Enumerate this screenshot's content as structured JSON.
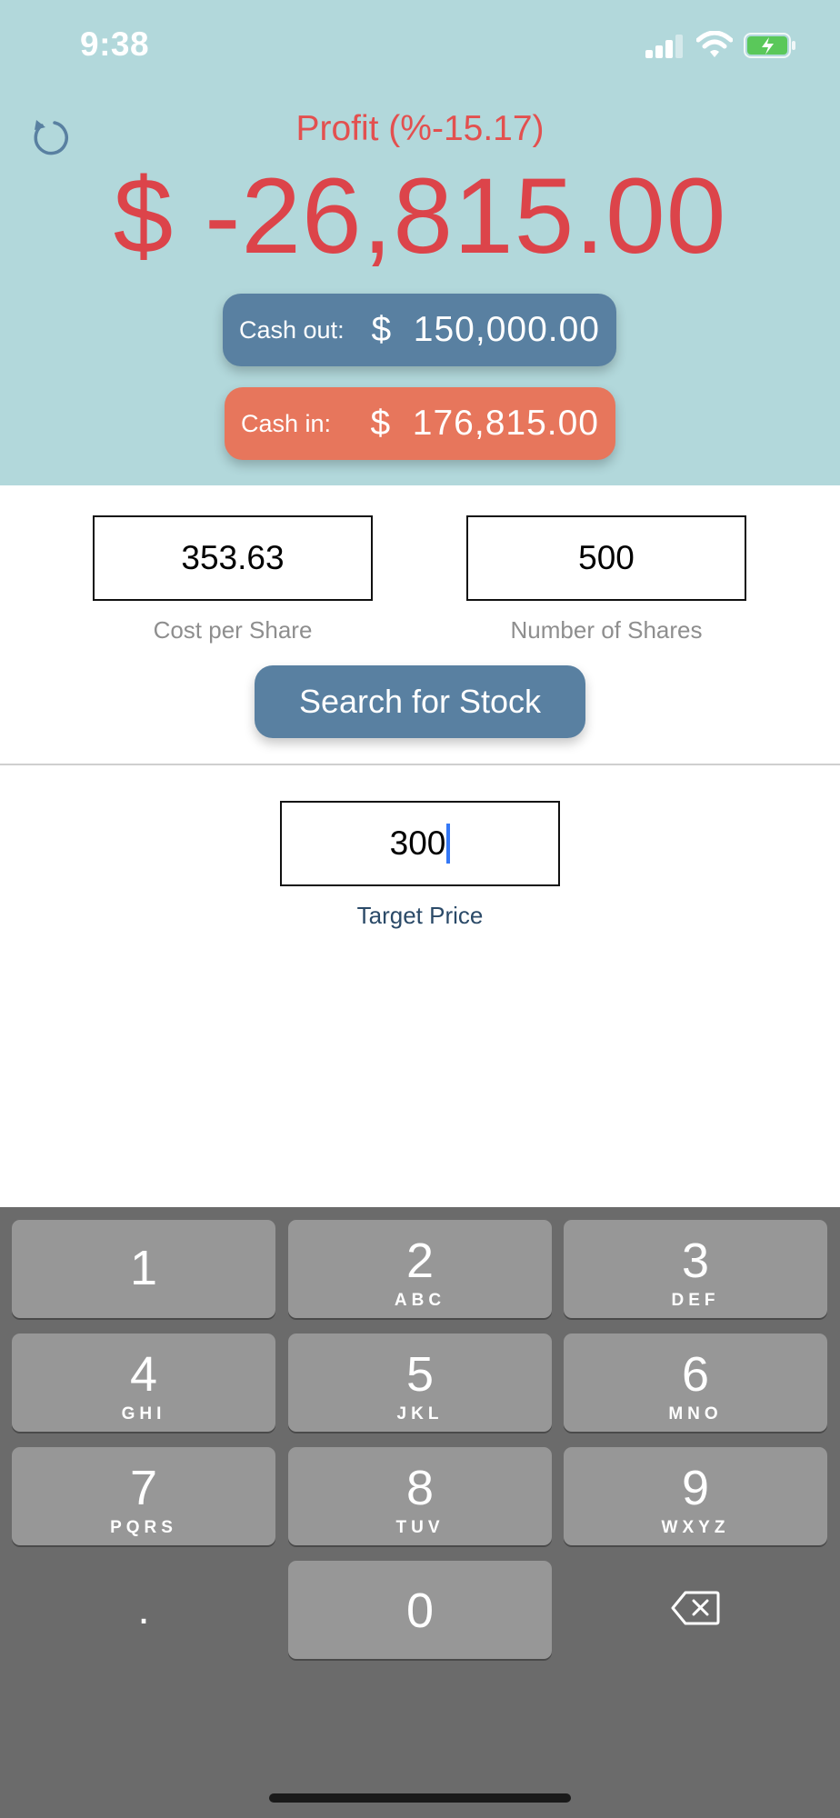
{
  "status_bar": {
    "time": "9:38",
    "icons": [
      "signal-icon",
      "wifi-icon",
      "battery-charging-icon"
    ]
  },
  "header": {
    "refresh_icon": "refresh-icon",
    "profit_label": "Profit (%-15.17)",
    "profit_amount": "$ -26,815.00",
    "cash_out": {
      "label": "Cash out:",
      "value": "$  150,000.00"
    },
    "cash_in": {
      "label": "Cash in:",
      "value": "$  176,815.00"
    }
  },
  "form": {
    "cost_per_share": {
      "value": "353.63",
      "label": "Cost per Share"
    },
    "number_of_shares": {
      "value": "500",
      "label": "Number of Shares"
    },
    "search_button": "Search for Stock",
    "target_price": {
      "value": "300",
      "label": "Target Price"
    }
  },
  "keypad": {
    "keys": [
      {
        "digit": "1",
        "letters": ""
      },
      {
        "digit": "2",
        "letters": "ABC"
      },
      {
        "digit": "3",
        "letters": "DEF"
      },
      {
        "digit": "4",
        "letters": "GHI"
      },
      {
        "digit": "5",
        "letters": "JKL"
      },
      {
        "digit": "6",
        "letters": "MNO"
      },
      {
        "digit": "7",
        "letters": "PQRS"
      },
      {
        "digit": "8",
        "letters": "TUV"
      },
      {
        "digit": "9",
        "letters": "WXYZ"
      },
      {
        "digit": "0",
        "letters": ""
      }
    ],
    "decimal": ".",
    "delete_icon": "backspace-icon"
  },
  "colors": {
    "header_bg": "#b2d8db",
    "profit_red": "#dc444a",
    "cash_out_blue": "#5980a1",
    "cash_in_orange": "#e7765c",
    "keypad_bg": "#6b6b6b",
    "key_bg": "#979797"
  }
}
